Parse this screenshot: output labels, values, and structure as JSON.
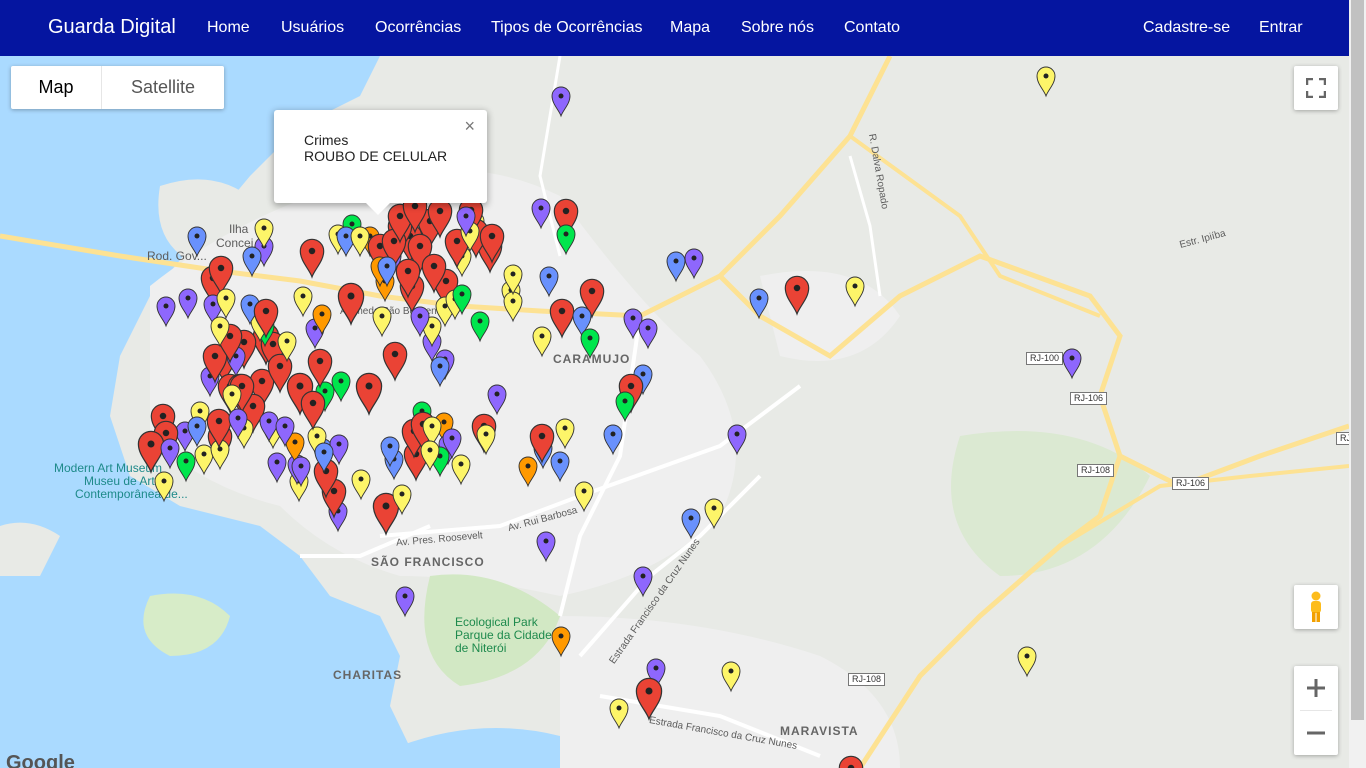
{
  "app": {
    "brand": "Guarda Digital"
  },
  "nav": {
    "left": [
      "Home",
      "Usuários",
      "Ocorrências",
      "Tipos de Ocorrências",
      "Mapa",
      "Sobre nós",
      "Contato"
    ],
    "right": [
      "Cadastre-se",
      "Entrar"
    ]
  },
  "map": {
    "maptype": {
      "map": "Map",
      "satellite": "Satellite"
    },
    "infowindow": {
      "category": "Crimes",
      "type": "ROUBO DE CELULAR",
      "close": "×"
    },
    "labels": {
      "caramujo": "CARAMUJO",
      "sao_francisco": "SÃO FRANCISCO",
      "charitas": "CHARITAS",
      "maravista": "MARAVISTA",
      "park1": "Ecological Park",
      "park2": "Parque da Cidade",
      "park3": "de Niterói",
      "museum1": "Modern Art Museum",
      "museum2": "Museu de Arte",
      "museum3": "Contemporânea de...",
      "ilha1": "Ilha",
      "ilha2": "Concei...",
      "rod": "Rod. Gov...",
      "estr_ipiiba": "Estr. Ipiíba",
      "av_rui": "Av. Rui Barbosa",
      "av_pres": "Av. Pres. Roosevelt",
      "estr_fcn": "Estrada Francisco da Cruz Nunes",
      "estr_fcn2": "Estrada Francisco da Cruz Nunes",
      "sao_boa": "Alameda São Boaventura",
      "r_dalva": "R. Dalva Ropado"
    },
    "shields": {
      "rj100": "RJ-100",
      "rj106a": "RJ-106",
      "rj108a": "RJ-108",
      "rj106b": "RJ-106",
      "rj108b": "RJ-108",
      "rj": "RJ"
    },
    "google": "Google",
    "colors": {
      "red": "#ea4335",
      "yellow": "#fdf569",
      "purple": "#8e67fd",
      "blue": "#6991fd",
      "green": "#00e64d",
      "orange": "#ff9900",
      "navbar": "#0515a0"
    }
  }
}
